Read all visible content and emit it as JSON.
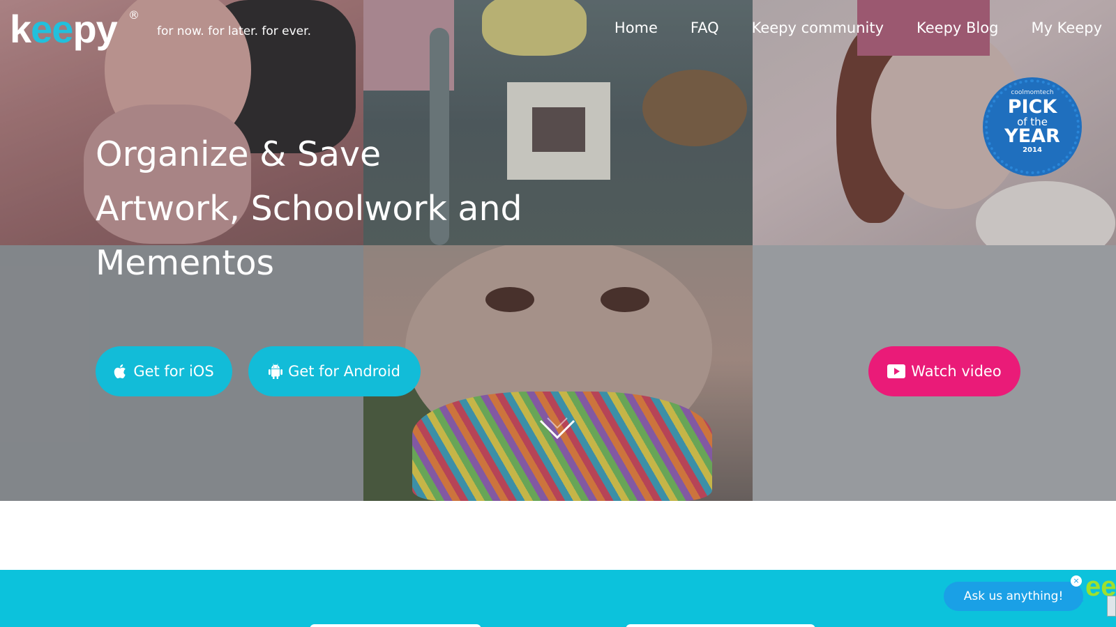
{
  "header": {
    "logo_text_k": "k",
    "logo_text_ee": "ee",
    "logo_text_py": "py",
    "logo_reg": "®",
    "tagline": "for now. for later. for ever.",
    "nav": [
      {
        "label": "Home"
      },
      {
        "label": "FAQ"
      },
      {
        "label": "Keepy community"
      },
      {
        "label": "Keepy Blog"
      },
      {
        "label": "My Keepy"
      }
    ]
  },
  "badge": {
    "top": "coolmomtech",
    "pick": "PICK",
    "of": "of the",
    "year": "YEAR",
    "yr": "2014"
  },
  "hero": {
    "headline_line1": "Organize & Save",
    "headline_line2": "Artwork, Schoolwork and",
    "headline_line3": "Mementos",
    "ios_label": "Get for iOS",
    "android_label": "Get for Android",
    "video_label": "Watch video"
  },
  "chat": {
    "label": "Ask us anything!",
    "close": "×",
    "logo": "ee"
  },
  "colors": {
    "brand_cyan": "#12bcd8",
    "brand_pink": "#ea1b78",
    "teal_band": "#0cc2dc",
    "chat_blue": "#1aa0e6",
    "badge_blue": "#1f6fbe"
  },
  "icons": {
    "ios": "apple-icon",
    "android": "android-icon",
    "video": "play-icon",
    "scroll": "chevron-down-icon"
  }
}
